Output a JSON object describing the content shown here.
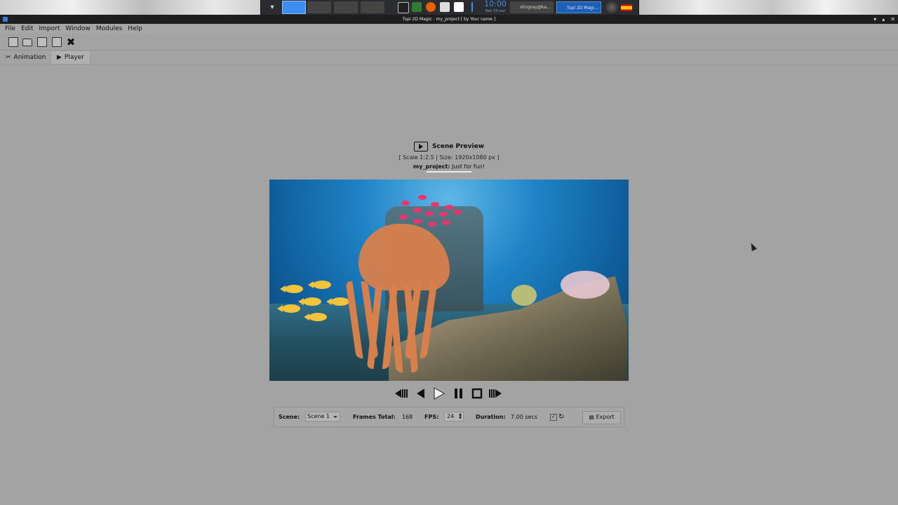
{
  "desktop": {
    "clock_time": "10:00",
    "clock_date": "Nov 13 sun",
    "tasks": [
      "xtingray@ka...",
      "Tupi 2D Magi..."
    ]
  },
  "window": {
    "title": "Tupi 2D Magic - my_project [ by Your name ]",
    "minimize": "▾",
    "maximize": "▴",
    "close": "✕"
  },
  "menu": [
    "File",
    "Edit",
    "Import",
    "Window",
    "Modules",
    "Help"
  ],
  "modes": {
    "animation": "Animation",
    "player": "Player"
  },
  "preview": {
    "title": "Scene Preview",
    "scale_info": "[ Scale 1:2.5 | Size: 1920x1080 px ]",
    "project_name": "my_project:",
    "project_desc": "Just for fun!"
  },
  "status": {
    "scene_label": "Scene:",
    "scene_value": "Scene 1",
    "frames_label": "Frames Total:",
    "frames_value": "168",
    "fps_label": "FPS:",
    "fps_value": "24",
    "duration_label": "Duration:",
    "duration_value": "7.00 secs",
    "loop_checked": "✓",
    "export_label": "Export"
  },
  "colors": {
    "background": "#a3a3a3",
    "taskbar": "#2a2c2f",
    "accent": "#3d8ef0",
    "jellyfish": "#d8804c"
  }
}
